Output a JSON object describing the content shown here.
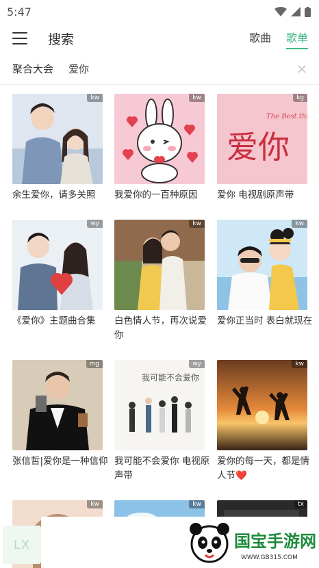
{
  "status_bar": {
    "time": "5:47"
  },
  "header": {
    "title": "搜索",
    "tabs": [
      "歌曲",
      "歌单"
    ],
    "active_tab": 1
  },
  "search": {
    "source": "聚合大会",
    "query": "爱你"
  },
  "playlists": [
    {
      "name": "余生爱你，请多关照",
      "badge": "kw"
    },
    {
      "name": "我爱你的一百种原因",
      "badge": "kw"
    },
    {
      "name": "爱你 电视剧原声带",
      "badge": "kg"
    },
    {
      "name": "《爱你》主题曲合集",
      "badge": "wy"
    },
    {
      "name": "白色情人节，再次说爱你",
      "badge": "kw"
    },
    {
      "name": "爱你正当时 表白就现在",
      "badge": "kw"
    },
    {
      "name": "张信哲|爱你是一种信仰",
      "badge": "mg"
    },
    {
      "name": "我可能不会爱你 电视原声带",
      "badge": "wy"
    },
    {
      "name": "爱你的每一天，都是情人节❤️",
      "badge": "kw"
    },
    {
      "name": "",
      "badge": "kw"
    },
    {
      "name": "",
      "badge": "kw"
    },
    {
      "name": "",
      "badge": "tx"
    }
  ],
  "covers": {
    "c1_text": "",
    "c3_text": "爱你",
    "c3_sub": "The Best thing",
    "c8_text": "我可能不会爱你"
  },
  "player": {
    "logo": "LX"
  },
  "watermark": {
    "brand": "国宝手游网",
    "url": "WWW.GB315.COM"
  },
  "colors": {
    "accent": "#3fb883"
  }
}
